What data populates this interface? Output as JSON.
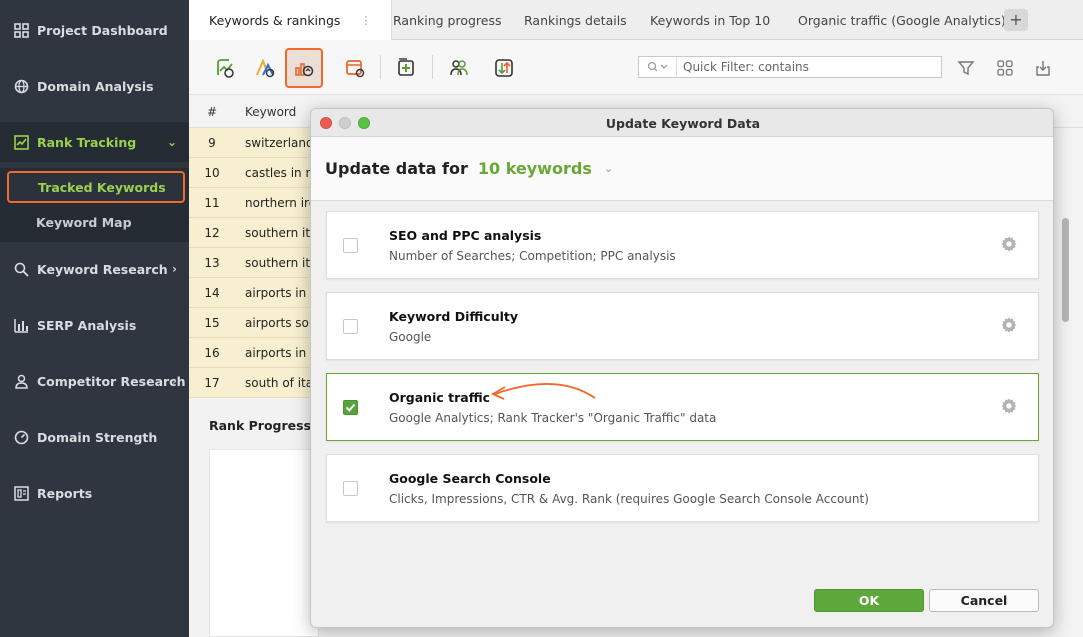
{
  "sidebar": {
    "items": [
      {
        "label": "Project Dashboard",
        "icon": "grid-icon"
      },
      {
        "label": "Domain Analysis",
        "icon": "globe-icon"
      },
      {
        "label": "Rank Tracking",
        "icon": "chart-icon",
        "expanded": true
      },
      {
        "label": "Keyword Research",
        "icon": "search-icon"
      },
      {
        "label": "SERP Analysis",
        "icon": "bar-chart-icon"
      },
      {
        "label": "Competitor Research",
        "icon": "user-icon"
      },
      {
        "label": "Domain Strength",
        "icon": "gauge-icon"
      },
      {
        "label": "Reports",
        "icon": "report-icon"
      }
    ],
    "sub_items": [
      {
        "label": "Tracked Keywords",
        "selected": true
      },
      {
        "label": "Keyword Map",
        "selected": false
      }
    ]
  },
  "tabs": [
    {
      "label": "Keywords & rankings",
      "active": true
    },
    {
      "label": "Ranking progress"
    },
    {
      "label": "Rankings details"
    },
    {
      "label": "Keywords in Top 10"
    },
    {
      "label": "Organic traffic (Google Analytics)"
    }
  ],
  "toolbar": {
    "quick_filter_placeholder": "Quick Filter: contains"
  },
  "table": {
    "headers": [
      "#",
      "Keyword"
    ],
    "rows": [
      {
        "num": "9",
        "keyword": "switzerland"
      },
      {
        "num": "10",
        "keyword": "castles in n"
      },
      {
        "num": "11",
        "keyword": "northern ire"
      },
      {
        "num": "12",
        "keyword": "southern ita"
      },
      {
        "num": "13",
        "keyword": "southern ita"
      },
      {
        "num": "14",
        "keyword": "airports in s"
      },
      {
        "num": "15",
        "keyword": "airports sou"
      },
      {
        "num": "16",
        "keyword": "airports in s"
      },
      {
        "num": "17",
        "keyword": "south of ita"
      }
    ]
  },
  "rank_progress": {
    "title": "Rank Progress"
  },
  "dialog": {
    "title": "Update Keyword Data",
    "header_label": "Update data for",
    "header_value": "10 keywords",
    "options": [
      {
        "title": "SEO and PPC analysis",
        "description": "Number of Searches; Competition; PPC analysis",
        "checked": false
      },
      {
        "title": "Keyword Difficulty",
        "description": "Google",
        "checked": false
      },
      {
        "title": "Organic traffic",
        "description": "Google Analytics; Rank Tracker's \"Organic Traffic\" data",
        "checked": true
      },
      {
        "title": "Google Search Console",
        "description": "Clicks, Impressions, CTR & Avg. Rank (requires Google Search Console Account)",
        "checked": false
      }
    ],
    "ok_label": "OK",
    "cancel_label": "Cancel"
  },
  "colors": {
    "accent_green": "#6aa736",
    "highlight_orange": "#f06a2d",
    "sidebar_bg": "#2f3640"
  }
}
